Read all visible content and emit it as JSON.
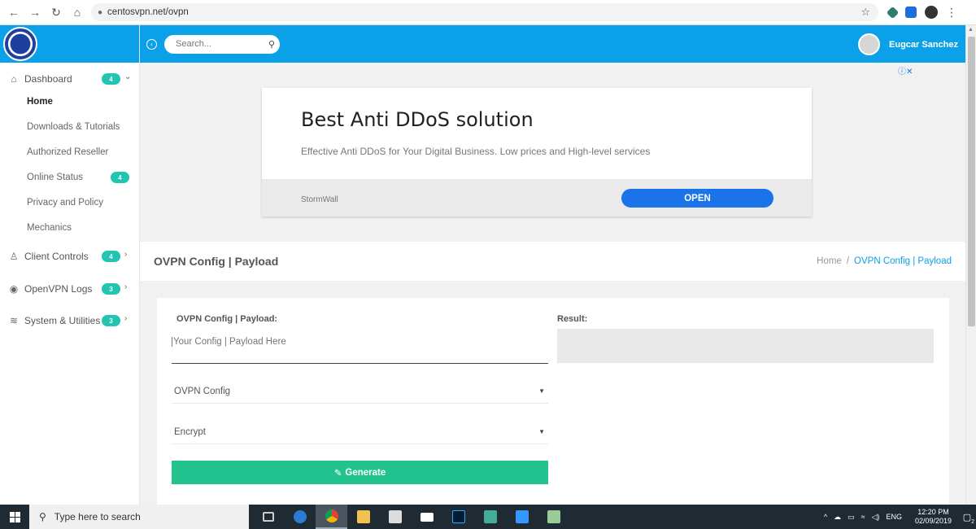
{
  "browser": {
    "url": "centosvpn.net/ovpn"
  },
  "header": {
    "search_placeholder": "Search...",
    "user_name": "Eugcar Sanchez"
  },
  "sidebar": {
    "items": [
      {
        "label": "Dashboard",
        "badge": "4",
        "icon": "home-icon"
      },
      {
        "label": "Client Controls",
        "badge": "4",
        "icon": "user-icon"
      },
      {
        "label": "OpenVPN Logs",
        "badge": "3",
        "icon": "globe-icon"
      },
      {
        "label": "System & Utilities",
        "badge": "3",
        "icon": "layers-icon"
      }
    ],
    "dashboard_sub": [
      {
        "label": "Home"
      },
      {
        "label": "Downloads & Tutorials"
      },
      {
        "label": "Authorized Reseller"
      },
      {
        "label": "Online Status",
        "badge": "4"
      },
      {
        "label": "Privacy and Policy"
      },
      {
        "label": "Mechanics"
      }
    ]
  },
  "ad": {
    "title": "Best Anti DDoS solution",
    "description": "Effective Anti DDoS for Your Digital Business. Low prices and High-level services",
    "brand": "StormWall",
    "cta": "OPEN"
  },
  "page": {
    "title": "OVPN Config | Payload",
    "breadcrumb": [
      "Home",
      "OVPN Config | Payload"
    ]
  },
  "form": {
    "payload_label": "OVPN Config | Payload:",
    "payload_placeholder": "Your Config | Payload Here",
    "result_label": "Result:",
    "select1_value": "OVPN Config",
    "select2_value": "Encrypt",
    "generate_label": "Generate"
  },
  "taskbar": {
    "search_placeholder": "Type here to search",
    "language": "ENG",
    "time": "12:20 PM",
    "date": "02/09/2019",
    "notifications": "2"
  },
  "colors": {
    "accent": "#0aa1e8",
    "badge": "#21c5b2",
    "generate": "#22c38f",
    "ad_button": "#1a73e8"
  }
}
